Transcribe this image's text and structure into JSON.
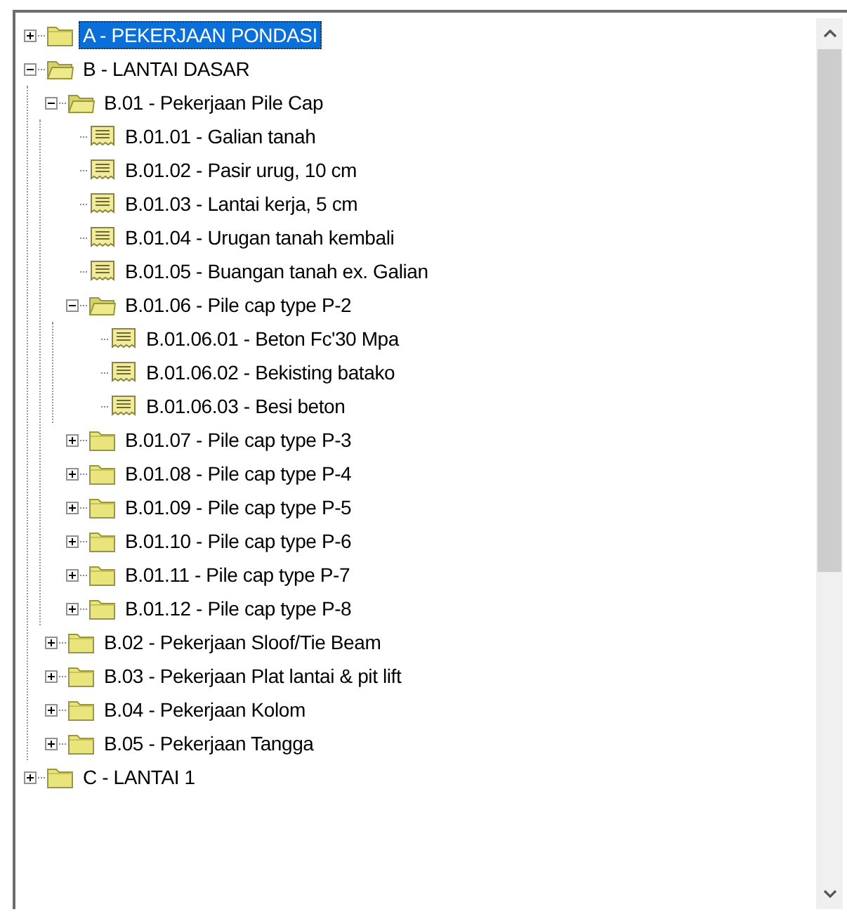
{
  "tree": [
    {
      "label": "A - PEKERJAAN PONDASI",
      "kind": "folder",
      "expanded": false,
      "selected": true
    },
    {
      "label": "B - LANTAI DASAR",
      "kind": "folder",
      "expanded": true,
      "selected": false,
      "children": [
        {
          "label": "B.01 - Pekerjaan Pile Cap",
          "kind": "folder",
          "expanded": true,
          "selected": false,
          "children": [
            {
              "label": "B.01.01 - Galian tanah",
              "kind": "item",
              "selected": false
            },
            {
              "label": "B.01.02 - Pasir urug, 10 cm",
              "kind": "item",
              "selected": false
            },
            {
              "label": "B.01.03 - Lantai kerja, 5 cm",
              "kind": "item",
              "selected": false
            },
            {
              "label": "B.01.04 - Urugan tanah kembali",
              "kind": "item",
              "selected": false
            },
            {
              "label": "B.01.05 - Buangan tanah ex. Galian",
              "kind": "item",
              "selected": false
            },
            {
              "label": "B.01.06 - Pile cap type P-2",
              "kind": "folder",
              "expanded": true,
              "selected": false,
              "children": [
                {
                  "label": "B.01.06.01 - Beton Fc'30 Mpa",
                  "kind": "item",
                  "selected": false
                },
                {
                  "label": "B.01.06.02 - Bekisting batako",
                  "kind": "item",
                  "selected": false
                },
                {
                  "label": "B.01.06.03 - Besi beton",
                  "kind": "item",
                  "selected": false
                }
              ]
            },
            {
              "label": "B.01.07 - Pile cap type P-3",
              "kind": "folder",
              "expanded": false,
              "selected": false
            },
            {
              "label": "B.01.08 - Pile cap type P-4",
              "kind": "folder",
              "expanded": false,
              "selected": false
            },
            {
              "label": "B.01.09 - Pile cap type P-5",
              "kind": "folder",
              "expanded": false,
              "selected": false
            },
            {
              "label": "B.01.10 - Pile cap type P-6",
              "kind": "folder",
              "expanded": false,
              "selected": false
            },
            {
              "label": "B.01.11 - Pile cap type P-7",
              "kind": "folder",
              "expanded": false,
              "selected": false
            },
            {
              "label": "B.01.12 - Pile cap type P-8",
              "kind": "folder",
              "expanded": false,
              "selected": false
            }
          ]
        },
        {
          "label": "B.02 - Pekerjaan Sloof/Tie Beam",
          "kind": "folder",
          "expanded": false,
          "selected": false
        },
        {
          "label": "B.03 - Pekerjaan Plat lantai & pit lift",
          "kind": "folder",
          "expanded": false,
          "selected": false
        },
        {
          "label": "B.04 - Pekerjaan Kolom",
          "kind": "folder",
          "expanded": false,
          "selected": false
        },
        {
          "label": "B.05 - Pekerjaan Tangga",
          "kind": "folder",
          "expanded": false,
          "selected": false
        }
      ]
    },
    {
      "label": "C - LANTAI 1",
      "kind": "folder",
      "expanded": false,
      "selected": false
    }
  ]
}
